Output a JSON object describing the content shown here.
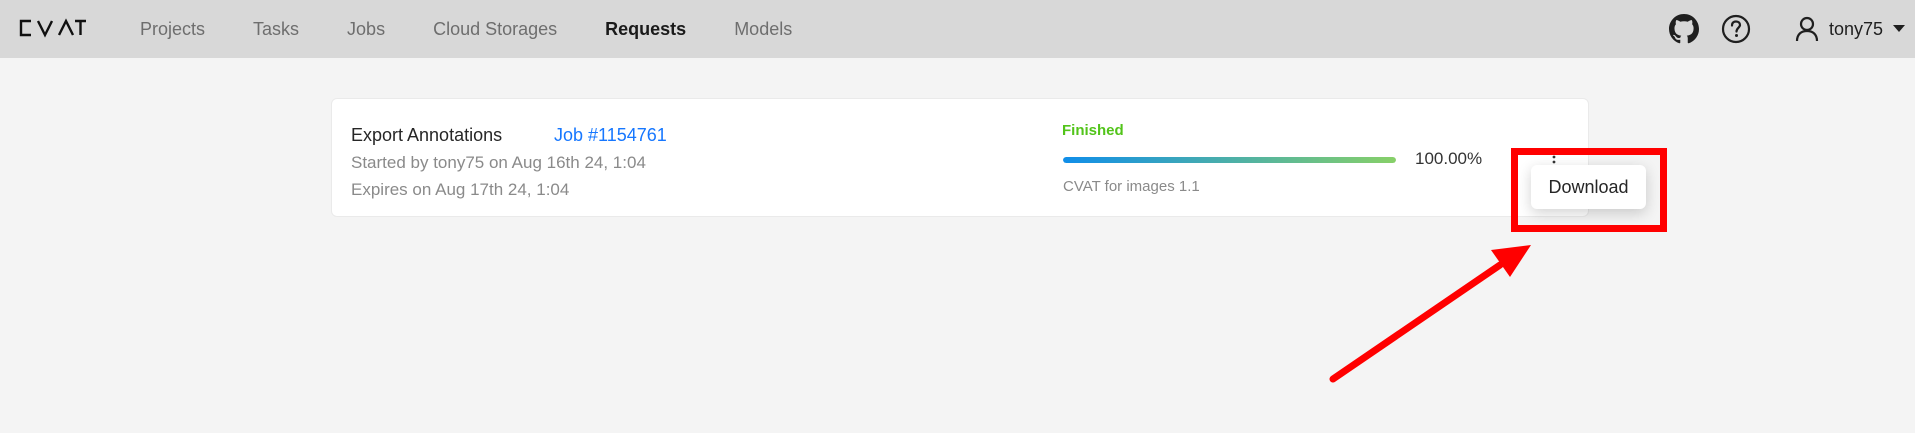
{
  "app": {
    "logo_text": "CVAT"
  },
  "nav": {
    "items": [
      {
        "label": "Projects",
        "active": false
      },
      {
        "label": "Tasks",
        "active": false
      },
      {
        "label": "Jobs",
        "active": false
      },
      {
        "label": "Cloud Storages",
        "active": false
      },
      {
        "label": "Requests",
        "active": true
      },
      {
        "label": "Models",
        "active": false
      }
    ]
  },
  "header_right": {
    "icons": [
      "github-icon",
      "help-icon",
      "user-icon",
      "caret-down-icon"
    ],
    "username": "tony75"
  },
  "request": {
    "title": "Export Annotations",
    "job_link": "Job #1154761",
    "started": "Started by tony75 on Aug 16th 24, 1:04",
    "expires": "Expires on Aug 17th 24, 1:04",
    "status": "Finished",
    "progress": 1.0,
    "progress_text": "100.00%",
    "format": "CVAT for images 1.1",
    "more_icon": "more-vertical-icon"
  },
  "dropdown": {
    "items": [
      "Download"
    ]
  },
  "colors": {
    "topbar": "#d8d8d8",
    "link": "#1677ff",
    "status_ok": "#52c41a",
    "progress_start": "#108ee9",
    "progress_end": "#87d068",
    "annotation": "#ff0000"
  }
}
